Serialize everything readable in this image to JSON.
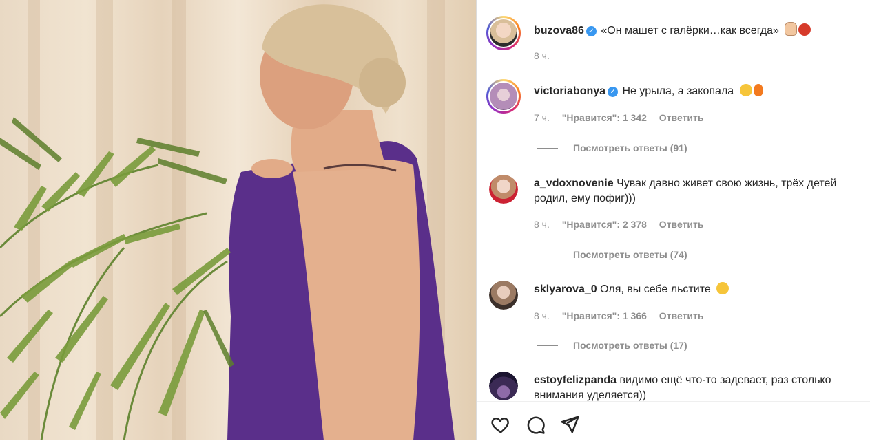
{
  "comments": [
    {
      "username": "buzova86",
      "verified": true,
      "text": "«Он машет с галёрки…как всегда»",
      "emoji": [
        "hand",
        "devil"
      ],
      "time": "8 ч."
    },
    {
      "username": "victoriabonya",
      "verified": true,
      "text": "Не урыла, а закопала",
      "emoji": [
        "laugh",
        "fire"
      ],
      "time": "7 ч.",
      "likes": "\"Нравится\": 1 342",
      "reply": "Ответить",
      "view_replies": "Посмотреть ответы (91)"
    },
    {
      "username": "a_vdoxnovenie",
      "verified": false,
      "text": "Чувак давно живет свою жизнь, трёх детей родил, ему пофиг)))",
      "time": "8 ч.",
      "likes": "\"Нравится\": 2 378",
      "reply": "Ответить",
      "view_replies": "Посмотреть ответы (74)"
    },
    {
      "username": "sklyarova_0",
      "verified": false,
      "text": "Оля, вы себе льстите",
      "emoji": [
        "laugh"
      ],
      "time": "8 ч.",
      "likes": "\"Нравится\": 1 366",
      "reply": "Ответить",
      "view_replies": "Посмотреть ответы (17)"
    },
    {
      "username": "estoyfelizpanda",
      "verified": false,
      "text": "видимо ещё что-то задевает, раз столько внимания уделяется))"
    }
  ],
  "actions": {
    "like": "heart-icon",
    "comment": "comment-icon",
    "share": "share-icon"
  },
  "colors": {
    "verified": "#3897f0",
    "muted": "#8e8e8e",
    "dress": "#5a2f8a"
  }
}
